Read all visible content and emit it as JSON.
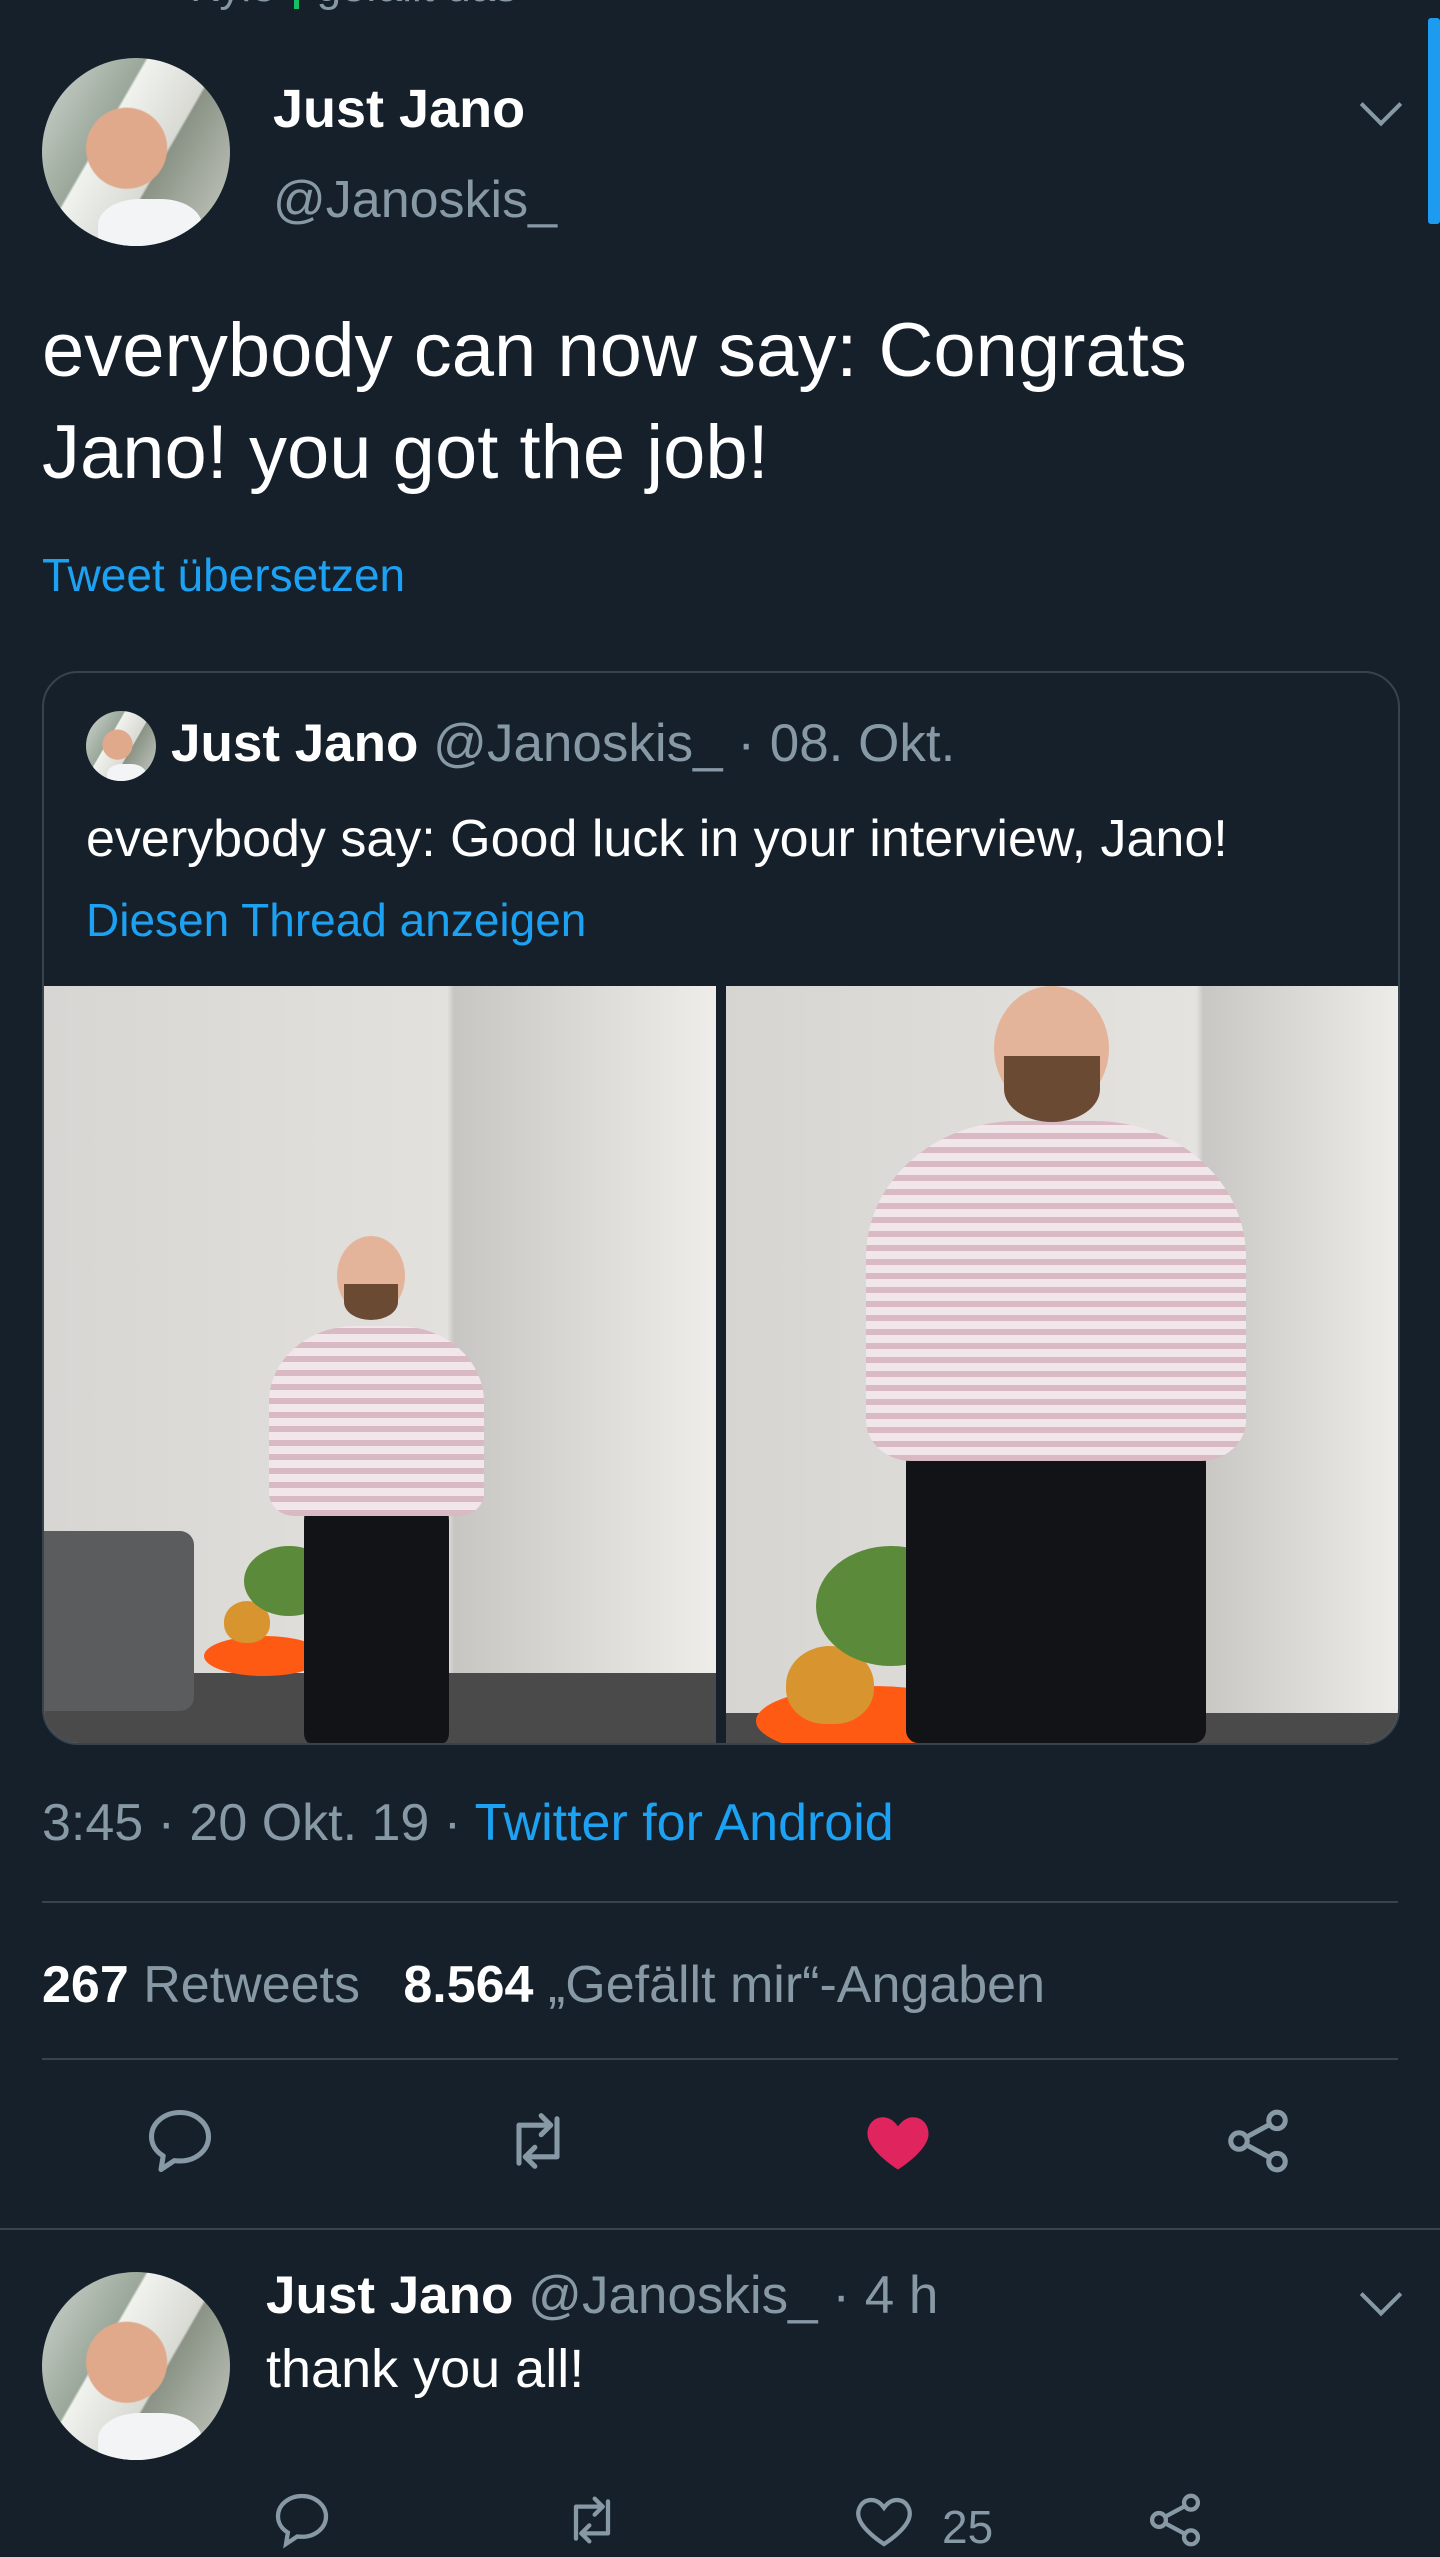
{
  "context_bar": {
    "left": "Kyle",
    "right": "gefällt das"
  },
  "tweet": {
    "author_name": "Just Jano",
    "author_handle": "@Janoskis_",
    "text": "everybody can now say: Congrats Jano! you got the job!",
    "translate_label": "Tweet übersetzen",
    "quote": {
      "author_name": "Just Jano",
      "author_handle": "@Janoskis_",
      "date": "· 08. Okt.",
      "text": "everybody say: Good luck in your interview, Jano!",
      "thread_link": "Diesen Thread anzeigen"
    },
    "meta": {
      "time_date": "3:45 · 20 Okt. 19 ·",
      "client": "Twitter for Android"
    },
    "stats": {
      "retweets_count": "267",
      "retweets_label": "Retweets",
      "likes_count": "8.564",
      "likes_label": "„Gefällt mir“-Angaben"
    },
    "actions": {
      "liked": true,
      "like_color": "#e0245e"
    }
  },
  "reply": {
    "author_name": "Just Jano",
    "author_handle": "@Janoskis_",
    "time": "· 4 h",
    "text": "thank you all!",
    "like_count": "25"
  },
  "colors": {
    "background": "#15202b",
    "accent": "#1da1f2",
    "muted": "#8899a6",
    "border": "#38444d"
  }
}
